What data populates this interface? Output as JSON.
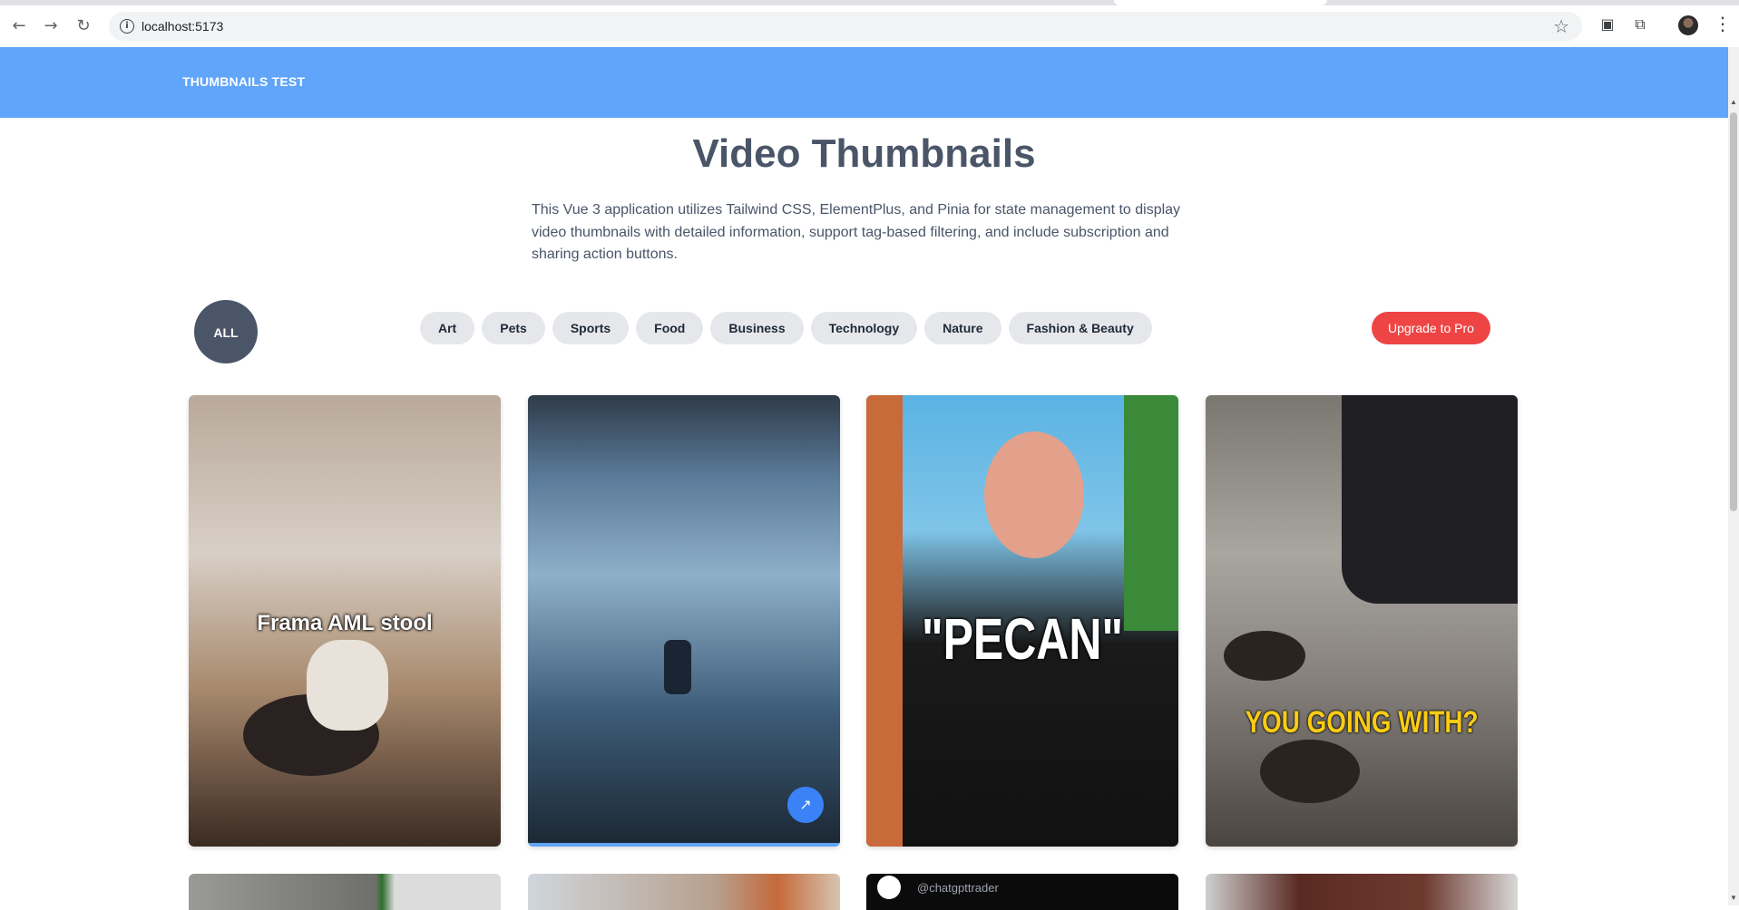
{
  "browser": {
    "url": "localhost:5173",
    "icons": [
      "back-icon",
      "forward-icon",
      "reload-icon",
      "info-icon",
      "star-icon",
      "extension-puzzle-icon",
      "kebab-menu-icon"
    ]
  },
  "header": {
    "brand": "THUMBNAILS TEST"
  },
  "main": {
    "title": "Video Thumbnails",
    "description": "This Vue 3 application utilizes Tailwind CSS, ElementPlus, and Pinia for state management to display video thumbnails with detailed information, support tag-based filtering, and include subscription and sharing action buttons."
  },
  "filters": {
    "all_label": "ALL",
    "tags": [
      "Art",
      "Pets",
      "Sports",
      "Food",
      "Business",
      "Technology",
      "Nature",
      "Fashion & Beauty"
    ],
    "upgrade_label": "Upgrade to Pro"
  },
  "videos": [
    {
      "caption": "Frama AML stool"
    },
    {
      "caption": ""
    },
    {
      "caption": "\"PECAN\""
    },
    {
      "caption": "YOU GOING WITH?"
    }
  ],
  "videos_row2": [
    {
      "caption": ""
    },
    {
      "caption": ""
    },
    {
      "caption": "@chatgpttrader"
    },
    {
      "caption": ""
    }
  ],
  "colors": {
    "header": "#60a5fa",
    "all_button": "#4a5568",
    "upgrade": "#ef4444",
    "share": "#3b82f6"
  }
}
